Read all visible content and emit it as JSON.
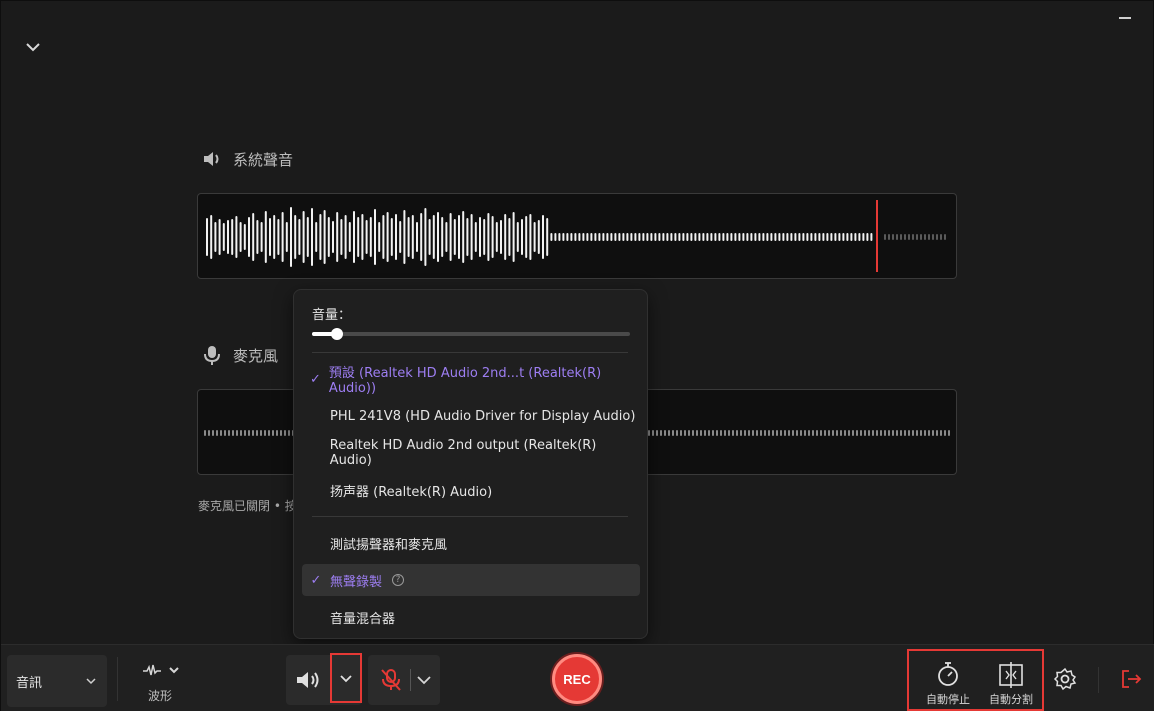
{
  "system_audio": {
    "title": "系統聲音",
    "icon": "speaker-icon"
  },
  "microphone": {
    "title": "麥克風",
    "icon": "mic-icon",
    "status": "麥克風已關閉 • 按"
  },
  "dropdown": {
    "volume_label": "音量：",
    "volume_level": 0.08,
    "devices": [
      {
        "label": "預設 (Realtek HD Audio 2nd...t (Realtek(R) Audio))",
        "selected": true
      },
      {
        "label": "PHL 241V8 (HD Audio Driver for Display Audio)",
        "selected": false
      },
      {
        "label": "Realtek HD Audio 2nd output (Realtek(R) Audio)",
        "selected": false
      },
      {
        "label": "扬声器 (Realtek(R) Audio)",
        "selected": false
      }
    ],
    "test_label": "測試揚聲器和麥克風",
    "silent_label": "無聲錄製",
    "silent_checked": true,
    "mixer_label": "音量混合器",
    "check_glyph": "✓",
    "help_glyph": "?"
  },
  "toolbar": {
    "mode_label": "音訊",
    "waveform_label": "波形",
    "rec_label": "REC",
    "auto_stop_label": "自動停止",
    "auto_split_label": "自動分割"
  },
  "colors": {
    "accent": "#9d7ef2",
    "rec": "#e53935",
    "highlight_border": "#e53935"
  }
}
